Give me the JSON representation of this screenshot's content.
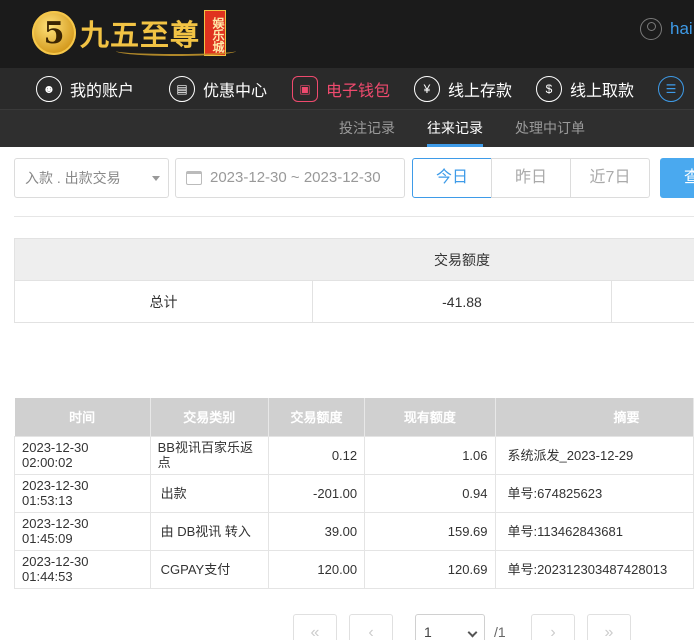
{
  "brand": {
    "badge": "5",
    "name": "九五至尊",
    "sub": "娱乐城"
  },
  "user": {
    "name": "hai"
  },
  "nav": [
    {
      "label": "我的账户",
      "icon": "user-icon"
    },
    {
      "label": "优惠中心",
      "icon": "gift-icon"
    },
    {
      "label": "电子钱包",
      "icon": "wallet-icon"
    },
    {
      "label": "线上存款",
      "icon": "deposit-icon"
    },
    {
      "label": "线上取款",
      "icon": "withdraw-icon"
    }
  ],
  "subnav": [
    {
      "label": "投注记录"
    },
    {
      "label": "往来记录"
    },
    {
      "label": "处理中订单"
    }
  ],
  "filters": {
    "type_select": "入款 . 出款交易",
    "date_range": "2023-12-30 ~ 2023-12-30",
    "periods": [
      "今日",
      "昨日",
      "近7日"
    ],
    "search_label": "查"
  },
  "summary": {
    "header": "交易额度",
    "total_label": "总计",
    "total_value": "-41.88"
  },
  "records": {
    "columns": [
      "时间",
      "交易类别",
      "交易额度",
      "现有额度",
      "摘要"
    ],
    "rows": [
      [
        "2023-12-30 02:00:02",
        "BB视讯百家乐返点",
        "0.12",
        "1.06",
        "系统派发_2023-12-29"
      ],
      [
        "2023-12-30 01:53:13",
        "出款",
        "-201.00",
        "0.94",
        "单号:674825623"
      ],
      [
        "2023-12-30 01:45:09",
        "由 DB视讯 转入",
        "39.00",
        "159.69",
        "单号:113462843681"
      ],
      [
        "2023-12-30 01:44:53",
        "CGPAY支付",
        "120.00",
        "120.69",
        "单号:202312303487428013"
      ]
    ]
  },
  "pagination": {
    "current_page": "1",
    "total_pages": "/1"
  }
}
